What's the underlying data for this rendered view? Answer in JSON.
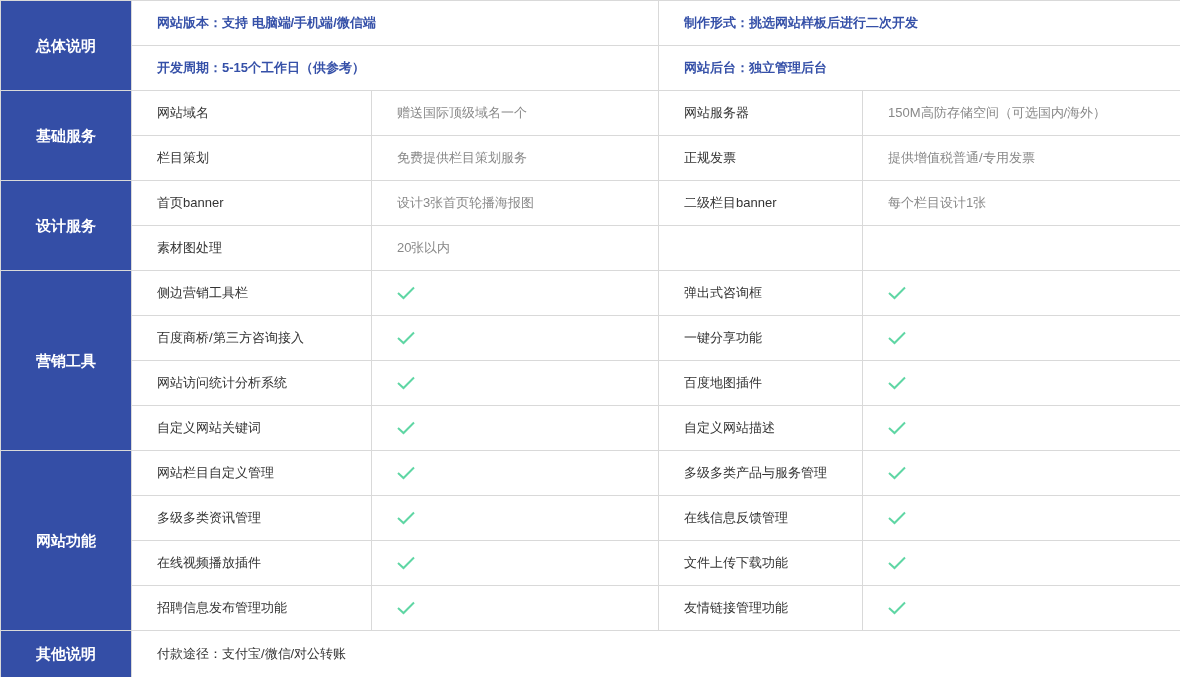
{
  "sections": [
    {
      "title": "总体说明",
      "rows": [
        {
          "kind": "highlight",
          "items": [
            {
              "text": "网站版本：支持 电脑端/手机端/微信端"
            },
            {
              "text": "制作形式：挑选网站样板后进行二次开发"
            }
          ]
        },
        {
          "kind": "highlight",
          "items": [
            {
              "text": "开发周期：5-15个工作日（供参考）"
            },
            {
              "text": "网站后台：独立管理后台"
            }
          ]
        }
      ]
    },
    {
      "title": "基础服务",
      "rows": [
        {
          "kind": "pair",
          "items": [
            {
              "label": "网站域名",
              "value": "赠送国际顶级域名一个"
            },
            {
              "label": "网站服务器",
              "value": "150M高防存储空间（可选国内/海外）"
            }
          ]
        },
        {
          "kind": "pair",
          "items": [
            {
              "label": "栏目策划",
              "value": "免费提供栏目策划服务"
            },
            {
              "label": "正规发票",
              "value": "提供增值税普通/专用发票"
            }
          ]
        }
      ]
    },
    {
      "title": "设计服务",
      "rows": [
        {
          "kind": "pair",
          "items": [
            {
              "label": "首页banner",
              "value": "设计3张首页轮播海报图"
            },
            {
              "label": "二级栏目banner",
              "value": "每个栏目设计1张"
            }
          ]
        },
        {
          "kind": "pair",
          "items": [
            {
              "label": "素材图处理",
              "value": "20张以内"
            }
          ]
        }
      ]
    },
    {
      "title": "营销工具",
      "rows": [
        {
          "kind": "check",
          "items": [
            {
              "label": "侧边营销工具栏",
              "checked": true
            },
            {
              "label": "弹出式咨询框",
              "checked": true
            }
          ]
        },
        {
          "kind": "check",
          "items": [
            {
              "label": "百度商桥/第三方咨询接入",
              "checked": true
            },
            {
              "label": "一键分享功能",
              "checked": true
            }
          ]
        },
        {
          "kind": "check",
          "items": [
            {
              "label": "网站访问统计分析系统",
              "checked": true
            },
            {
              "label": "百度地图插件",
              "checked": true
            }
          ]
        },
        {
          "kind": "check",
          "items": [
            {
              "label": "自定义网站关键词",
              "checked": true
            },
            {
              "label": "自定义网站描述",
              "checked": true
            }
          ]
        }
      ]
    },
    {
      "title": "网站功能",
      "rows": [
        {
          "kind": "check",
          "items": [
            {
              "label": "网站栏目自定义管理",
              "checked": true
            },
            {
              "label": "多级多类产品与服务管理",
              "checked": true
            }
          ]
        },
        {
          "kind": "check",
          "items": [
            {
              "label": "多级多类资讯管理",
              "checked": true
            },
            {
              "label": "在线信息反馈管理",
              "checked": true
            }
          ]
        },
        {
          "kind": "check",
          "items": [
            {
              "label": "在线视频播放插件",
              "checked": true
            },
            {
              "label": "文件上传下载功能",
              "checked": true
            }
          ]
        },
        {
          "kind": "check",
          "items": [
            {
              "label": "招聘信息发布管理功能",
              "checked": true
            },
            {
              "label": "友情链接管理功能",
              "checked": true
            }
          ]
        }
      ]
    },
    {
      "title": "其他说明",
      "rows": [
        {
          "kind": "note",
          "items": [
            {
              "text": "付款途径：支付宝/微信/对公转账"
            }
          ]
        }
      ]
    }
  ]
}
